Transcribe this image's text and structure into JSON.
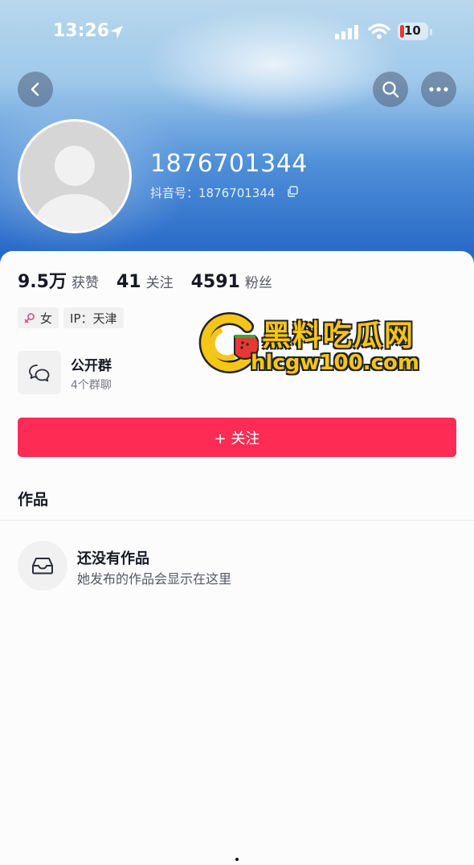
{
  "status_bar": {
    "time": "13:26",
    "battery": "10"
  },
  "profile": {
    "username": "1876701344",
    "douyin_id": "抖音号：1876701344"
  },
  "stats": [
    {
      "value": "9.5万",
      "label": "获赞"
    },
    {
      "value": "41",
      "label": "关注"
    },
    {
      "value": "4591",
      "label": "粉丝"
    }
  ],
  "tags": {
    "gender": "女",
    "ip": "IP：天津"
  },
  "group": {
    "title": "公开群",
    "subtitle": "4个群聊"
  },
  "follow_button": "+ 关注",
  "works": {
    "section_title": "作品",
    "empty_title": "还没有作品",
    "empty_subtitle": "她发布的作品会显示在这里"
  },
  "watermark": {
    "line1": "黑料吃瓜网",
    "line2": "hlcgw100.com"
  },
  "colors": {
    "accent": "#fe2c55",
    "watermark": "#f5c518"
  }
}
